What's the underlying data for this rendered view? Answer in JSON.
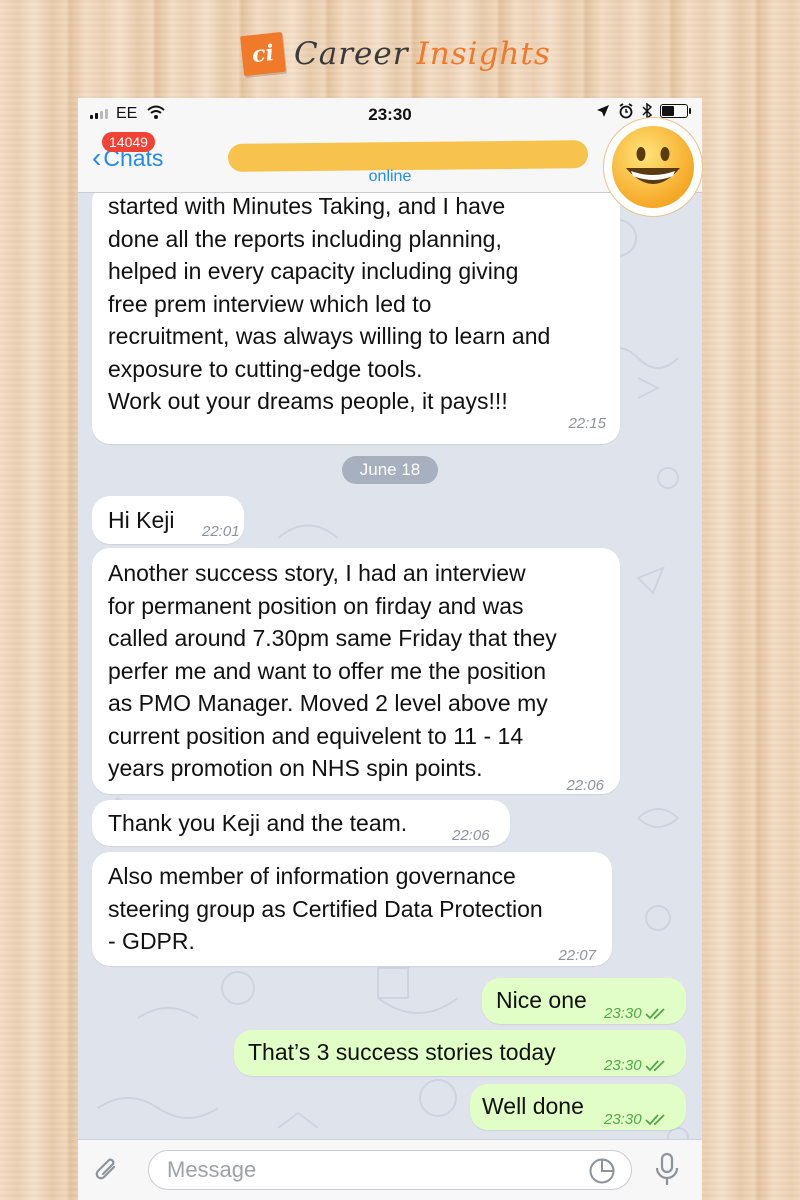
{
  "brand": {
    "logo": "ci",
    "name_part1": "Career",
    "name_part2": "Insights"
  },
  "status_bar": {
    "carrier": "EE",
    "time": "23:30",
    "icons": [
      "signal-icon",
      "wifi-icon",
      "location-icon",
      "alarm-icon",
      "bluetooth-icon",
      "battery-icon"
    ]
  },
  "chat_header": {
    "back_label": "Chats",
    "unread_badge": "14049",
    "status": "online",
    "avatar_icon": "grinning-face-emoji-icon"
  },
  "messages": [
    {
      "dir": "in",
      "text": "started with Minutes Taking, and  I have\ndone all the reports including planning,\nhelped in every capacity including giving\nfree prem interview which led to\nrecruitment, was always willing to learn and\nexposure to cutting-edge tools.\nWork out your dreams people, it pays!!!",
      "time": "22:15"
    },
    {
      "dir": "in",
      "text": "Hi Keji",
      "time": "22:01"
    },
    {
      "dir": "in",
      "text": "Another success story, I had an interview\nfor permanent position on firday and was\ncalled around 7.30pm same Friday that they\nperfer me and want to offer me the position\nas PMO Manager. Moved 2 level above my\ncurrent position and equivelent to 11 - 14\nyears promotion on NHS spin points.",
      "time": "22:06"
    },
    {
      "dir": "in",
      "text": "Thank you Keji and the team.",
      "time": "22:06"
    },
    {
      "dir": "in",
      "text": "Also member of information governance\nsteering group as Certified Data Protection\n- GDPR.",
      "time": "22:07"
    },
    {
      "dir": "out",
      "text": "Nice one",
      "time": "23:30"
    },
    {
      "dir": "out",
      "text": "That’s 3 success stories today",
      "time": "23:30"
    },
    {
      "dir": "out",
      "text": "Well done",
      "time": "23:30"
    }
  ],
  "date_separator": "June 18",
  "composer": {
    "placeholder": "Message"
  },
  "colors": {
    "accent": "#1e8cf0",
    "badge": "#f04335",
    "outgoing_bubble": "#e1fec6",
    "brand_orange": "#f0792a",
    "censor_yellow": "#f8c34d"
  }
}
